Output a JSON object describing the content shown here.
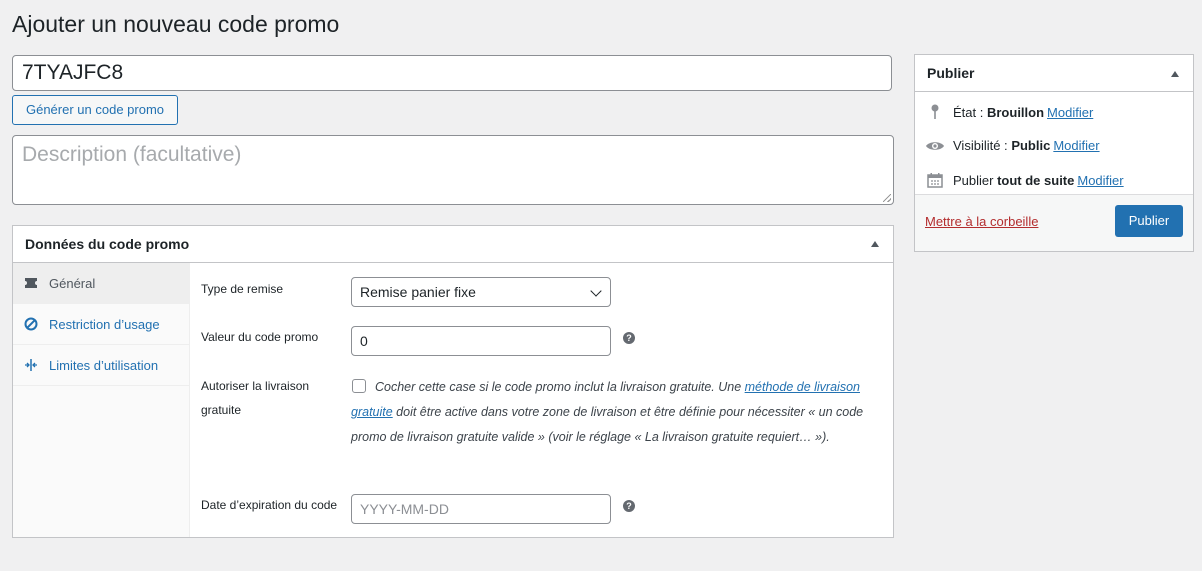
{
  "page": {
    "title": "Ajouter un nouveau code promo"
  },
  "coupon": {
    "code_value": "7TYAJFC8",
    "generate_label": "Générer un code promo",
    "description_placeholder": "Description (facultative)"
  },
  "coupon_data": {
    "title": "Données du code promo",
    "tabs": [
      {
        "label": "Général",
        "icon": "ticket-icon",
        "active": true
      },
      {
        "label": "Restriction d’usage",
        "icon": "ban-icon",
        "active": false
      },
      {
        "label": "Limites d’utilisation",
        "icon": "limits-icon",
        "active": false
      }
    ],
    "general": {
      "discount_type_label": "Type de remise",
      "discount_type_value": "Remise panier fixe",
      "amount_label": "Valeur du code promo",
      "amount_value": "0",
      "free_shipping_label_1": "Autoriser la livraison",
      "free_shipping_label_2": "gratuite",
      "free_shipping_text_1": "Cocher cette case si le code promo inclut la livraison gratuite. Une ",
      "free_shipping_link": "méthode de livraison gratuite",
      "free_shipping_text_2": " doit être active dans votre zone de livraison et être définie pour nécessiter « un code promo de livraison gratuite valide » (voir le réglage « La livraison gratuite requiert… »).",
      "expiry_label": "Date d’expiration du code",
      "expiry_placeholder": "YYYY-MM-DD",
      "help_glyph": "?"
    }
  },
  "publish": {
    "title": "Publier",
    "status_label": "État :",
    "status_value": "Brouillon",
    "visibility_label": "Visibilité :",
    "visibility_value": "Public",
    "schedule_label": "Publier",
    "schedule_value": "tout de suite",
    "edit_link": "Modifier",
    "trash_label": "Mettre à la corbeille",
    "publish_button": "Publier"
  },
  "colors": {
    "accent": "#2271b1",
    "trash": "#b32d2e",
    "background": "#f0f0f1"
  }
}
